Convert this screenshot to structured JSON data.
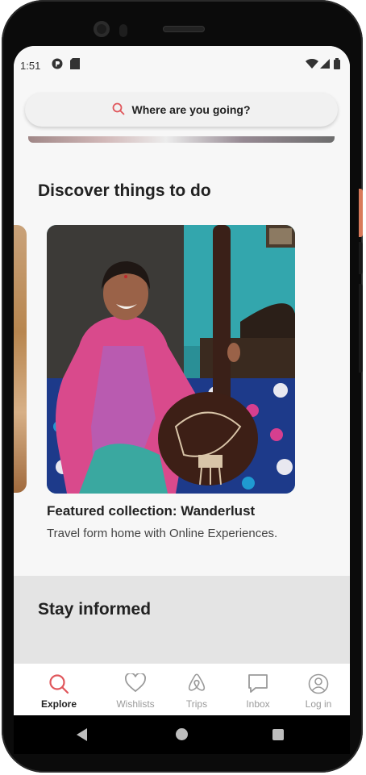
{
  "status_bar": {
    "time": "1:51"
  },
  "search": {
    "placeholder": "Where are you going?"
  },
  "discover": {
    "heading": "Discover things to do",
    "card": {
      "title": "Featured collection: Wanderlust",
      "subtitle": "Travel form home with Online Experiences."
    }
  },
  "stay_informed": {
    "heading": "Stay informed"
  },
  "tabs": [
    {
      "label": "Explore",
      "icon": "search-icon",
      "active": true
    },
    {
      "label": "Wishlists",
      "icon": "heart-icon",
      "active": false
    },
    {
      "label": "Trips",
      "icon": "airbnb-logo-icon",
      "active": false
    },
    {
      "label": "Inbox",
      "icon": "message-icon",
      "active": false
    },
    {
      "label": "Log in",
      "icon": "profile-icon",
      "active": false
    }
  ],
  "colors": {
    "accent": "#E0565B",
    "inactive": "#9A9A9A",
    "text": "#222222"
  }
}
